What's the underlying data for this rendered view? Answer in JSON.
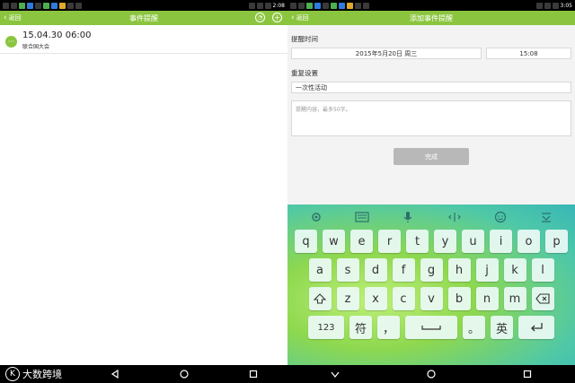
{
  "status_bar": {
    "left_time": "2:08",
    "right_time": "3:05"
  },
  "left_screen": {
    "back_label": "返回",
    "title": "事件提醒",
    "events": [
      {
        "time": "15.04.30  06:00",
        "title": "联合国大会"
      }
    ]
  },
  "right_screen": {
    "back_label": "返回",
    "title": "添加事件提醒",
    "reminder_time_label": "提醒时间",
    "date_value": "2015年5月20日 周三",
    "time_value": "15:08",
    "repeat_label": "重复设置",
    "repeat_value": "一次性活动",
    "content_placeholder": "提醒内容，最多50字。",
    "done_label": "完成"
  },
  "keyboard": {
    "row1": [
      "q",
      "w",
      "e",
      "r",
      "t",
      "y",
      "u",
      "i",
      "o",
      "p"
    ],
    "row2": [
      "a",
      "s",
      "d",
      "f",
      "g",
      "h",
      "j",
      "k",
      "l"
    ],
    "row3": [
      "z",
      "x",
      "c",
      "v",
      "b",
      "n",
      "m"
    ],
    "key_123": "123",
    "key_symbols": "符",
    "key_comma": "，",
    "key_period": "。",
    "key_lang": "英"
  },
  "watermark": {
    "text": "大数跨境"
  },
  "colors": {
    "accent": "#8bc53f"
  }
}
